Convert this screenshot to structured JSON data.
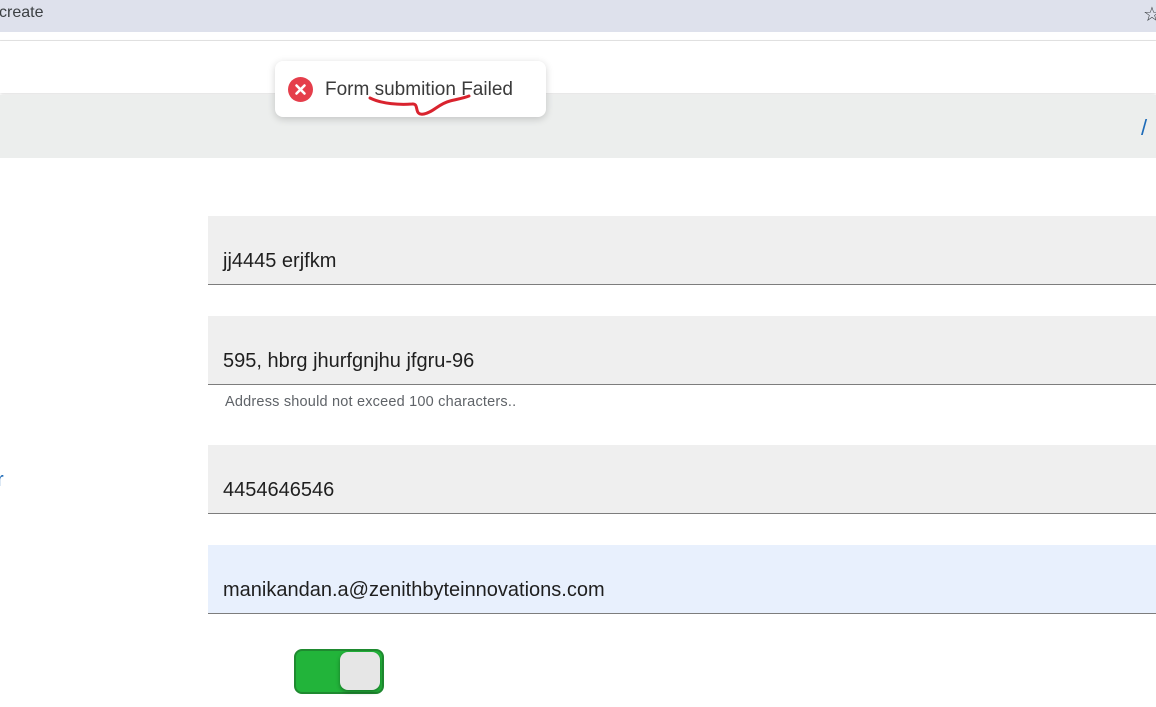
{
  "browser": {
    "url_fragment": "create",
    "bookmark_icon": "star-icon"
  },
  "breadcrumb": {
    "separator": "/"
  },
  "sidebar": {
    "partial_label": "r"
  },
  "form": {
    "fields": [
      {
        "value": "jj4445 erjfkm"
      },
      {
        "value": "595, hbrg jhurfgnjhu jfgru-96",
        "helper": "Address should not exceed 100 characters.."
      },
      {
        "value": "4454646546"
      },
      {
        "value": "manikandan.a@zenithbyteinnovations.com"
      }
    ],
    "toggle": {
      "state": "on"
    }
  },
  "toast": {
    "message": "Form submition Failed",
    "icon": "error-x-icon",
    "color": "#e53e4b"
  },
  "colors": {
    "accent": "#1e6bb8",
    "toggle_on": "#22b43a",
    "error": "#e53e4b"
  }
}
